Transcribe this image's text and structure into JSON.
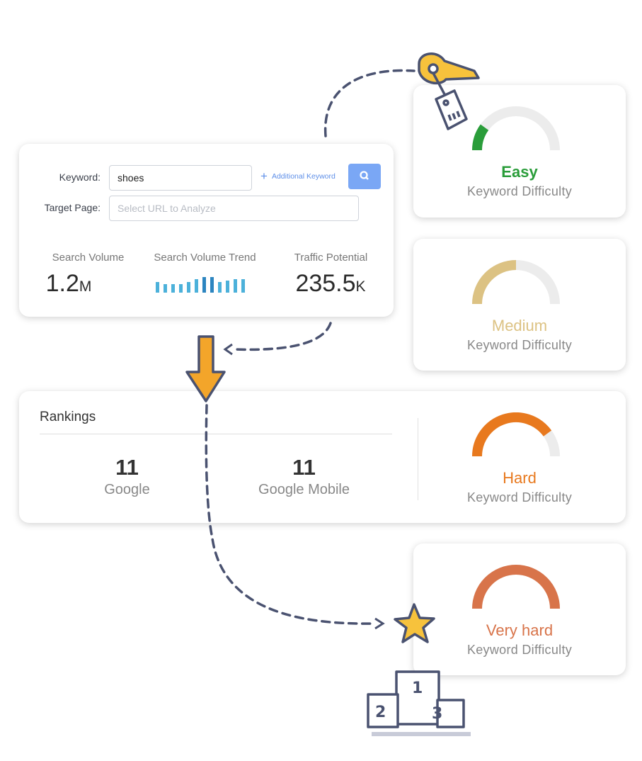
{
  "search_form": {
    "keyword_label": "Keyword:",
    "keyword_value": "shoes",
    "additional_keyword": "Additional Keyword",
    "target_page_label": "Target Page:",
    "target_page_placeholder": "Select URL to Analyze",
    "search_button_icon": "search-icon"
  },
  "stats": {
    "search_volume_label": "Search Volume",
    "search_volume_value": "1.2",
    "search_volume_unit": "M",
    "trend_label": "Search Volume Trend",
    "trend_values": [
      0.7,
      0.55,
      0.55,
      0.55,
      0.7,
      0.85,
      1,
      1,
      0.7,
      0.75,
      0.85,
      0.85
    ],
    "trend_highlight": [
      6,
      7
    ],
    "traffic_label": "Traffic Potential",
    "traffic_value": "235.5",
    "traffic_unit": "K"
  },
  "rankings": {
    "title": "Rankings",
    "items": [
      {
        "value": "11",
        "label": "Google"
      },
      {
        "value": "11",
        "label": "Google Mobile"
      }
    ]
  },
  "difficulty_cards": [
    {
      "level": "Easy",
      "label": "Keyword Difficulty",
      "fill": 0.2,
      "color": "#2a9d3a"
    },
    {
      "level": "Medium",
      "label": "Keyword Difficulty",
      "fill": 0.5,
      "color": "#dcc283"
    },
    {
      "level": "Hard",
      "label": "Keyword Difficulty",
      "fill": 0.8,
      "color": "#e8791e"
    },
    {
      "level": "Very hard",
      "label": "Keyword Difficulty",
      "fill": 1.0,
      "color": "#d8744a"
    }
  ],
  "colors": {
    "accent": "#7aa7f5",
    "arrow": "#f3a52a",
    "ink": "#4a5270",
    "gauge_track": "#ececec"
  },
  "podium": {
    "places": [
      "1",
      "2",
      "3"
    ]
  }
}
